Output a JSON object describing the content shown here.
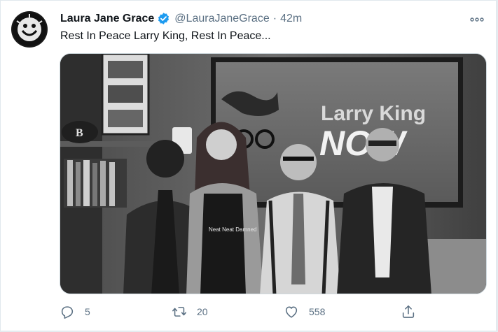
{
  "tweet": {
    "author_name": "Laura Jane Grace",
    "handle": "@LauraJaneGrace",
    "separator": "·",
    "time": "42m",
    "text": "Rest In Peace Larry King, Rest In Peace..."
  },
  "media": {
    "sign_line1": "Larry King",
    "sign_line2": "NOW",
    "shirt_text": "Neat Neat Damned",
    "cap_letter": "B"
  },
  "actions": {
    "replies": "5",
    "retweets": "20",
    "likes": "558"
  },
  "colors": {
    "verified": "#1d9bf0",
    "icon_gray": "#5b7083",
    "text": "#0f1419"
  }
}
